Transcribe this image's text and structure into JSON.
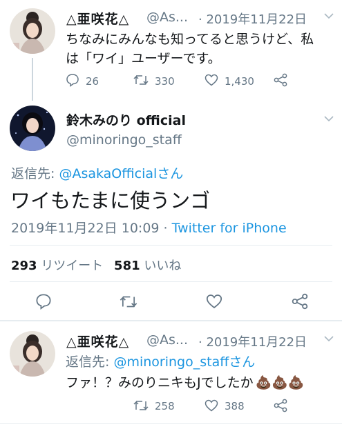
{
  "thread_tweet": {
    "author_name": "△亜咲花△",
    "author_handle": "@As...",
    "date": "· 2019年11月22日",
    "text_line1": "ちなみにみんなも知ってると思うけど、私",
    "text_line2": "は「ワイ」ユーザーです。",
    "reply_count": "26",
    "retweet_count": "330",
    "like_count": "1,430"
  },
  "main_tweet": {
    "author_name": "鈴木みのり official",
    "author_handle": "@minoringo_staff",
    "reply_label": "返信先: ",
    "reply_to": "@AsakaOfficialさん",
    "text": "ワイもたまに使うンゴ",
    "timestamp": "2019年11月22日 10:09 · ",
    "client": "Twitter for iPhone",
    "retweet_count": "293",
    "retweet_label": "リツイート",
    "like_count": "581",
    "like_label": "いいね"
  },
  "reply_tweet": {
    "author_name": "△亜咲花△",
    "author_handle": "@As...",
    "date": "· 2019年11月22日",
    "reply_label": "返信先: ",
    "reply_to": "@minoringo_staffさん",
    "text": "ファ！？みのりニキもJでしたか",
    "emoji": "💩💩💩",
    "retweet_count": "258",
    "like_count": "388"
  },
  "icons": {
    "reply": "reply-icon",
    "retweet": "retweet-icon",
    "like": "heart-icon",
    "share": "share-icon",
    "more": "chevron-down-icon"
  },
  "colors": {
    "link": "#1b95e0",
    "meta": "#657786",
    "text": "#14171a"
  }
}
